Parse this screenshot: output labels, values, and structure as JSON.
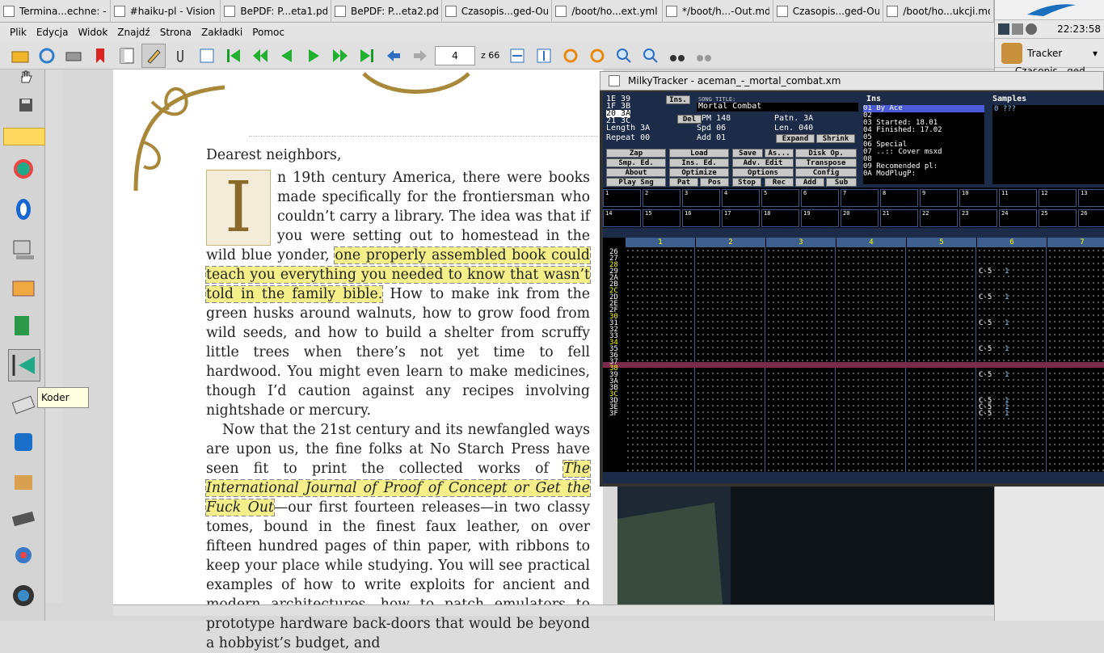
{
  "taskbar": {
    "tabs": [
      "Termina...echne: --",
      "#haiku-pl - Vision",
      "BePDF: P...eta1.pdf",
      "BePDF: P...eta2.pdf",
      "Czasopis...ged-Out",
      "/boot/ho...ext.yml",
      "*/boot/h...-Out.md",
      "Czasopis...ged-Out",
      "/boot/ho...ukcji.md"
    ]
  },
  "deskbar": {
    "clock": "22:23:58",
    "app_label": "Tracker",
    "window_item": "Czasopis...ged-Out"
  },
  "pdf": {
    "menu": [
      "Plik",
      "Edycja",
      "Widok",
      "Znajdź",
      "Strona",
      "Zakładki",
      "Pomoc"
    ],
    "page_number": "4",
    "page_total": "z 66",
    "tooltip": "Koder",
    "text": {
      "salutation": "Dearest neighbors,",
      "drop_cap": "I",
      "p1_a": "n 19th century America, there were books made specifically for the frontiersman who couldn’t carry a library. The idea was that if you were setting out to homestead in the wild blue yonder,",
      "p1_hl": "one properly assembled book could teach you everything you needed to know that wasn’t told in the family bible.",
      "p1_b": "How to make ink from the green husks around walnuts, how to grow food from wild seeds, and how to build a shelter from scruffy little trees when there’s not yet time to fell hardwood. You might even learn to make medicines, though I’d caution against any recipes involving nightshade or mercury.",
      "p2_a": "Now that the 21st century and its newfangled ways are upon us, the fine folks at No Starch Press have seen fit to print the collected works of",
      "p2_hl": "The International Journal of Proof of Concept or Get the Fuck Out",
      "p2_b": "—our first fourteen releases—in two classy tomes, bound in the finest faux leather, on over fifteen hundred pages of thin paper, with ribbons to keep your place while studying. You will see practical examples of how to write exploits for ancient and modern architectures, how to patch emulators to prototype hardware back-doors that would be beyond a hobbyist’s budget, and"
    }
  },
  "tracker": {
    "window_title": "MilkyTracker - aceman_-_mortal_combat.xm",
    "song_title_label": "SONG TITLE:",
    "song_title": "Mortal Combat",
    "order_list": [
      "1E 39",
      "1F 3B",
      "20 3A",
      "21 3C"
    ],
    "length": "Length 3A",
    "repeat": "Repeat 00",
    "bpm": "BPM 148",
    "spd": "Spd 06",
    "add": "Add 01",
    "patn": "Patn. 3A",
    "len": "Len. 040",
    "buttons": [
      "Ins.",
      "Del",
      "Expand",
      "Shrink",
      "Zap",
      "Load",
      "Save",
      "As...",
      "Disk Op.",
      "Smp. Ed.",
      "Ins. Ed.",
      "Adv. Edit",
      "Transpose",
      "About",
      "Optimize",
      "Options",
      "Config",
      "Play Sng",
      "Pat",
      "Pos",
      "Stop",
      "Rec",
      "Add",
      "Sub"
    ],
    "ins_header": "Ins",
    "ins_list": [
      "01 By Ace",
      "02",
      "03 Started: 18.01",
      "04 Finished: 17.02",
      "05",
      "06 Special",
      "07 ..:: Cover msxd",
      "08",
      "09 Recomended pl:",
      "0A ModPlugP:"
    ],
    "samples_header": "Samples",
    "samples_first": "0 ???",
    "channels": [
      "1",
      "2",
      "3",
      "4",
      "5",
      "6",
      "7"
    ],
    "rows": [
      "26",
      "27",
      "28",
      "29",
      "2A",
      "2B",
      "2C",
      "2D",
      "2E",
      "2F",
      "30",
      "31",
      "32",
      "33",
      "34",
      "35",
      "36",
      "37",
      "38",
      "39",
      "3A",
      "3B",
      "3C",
      "3D",
      "3E",
      "3F"
    ],
    "note_text": "C-5",
    "note_ins": "1"
  }
}
